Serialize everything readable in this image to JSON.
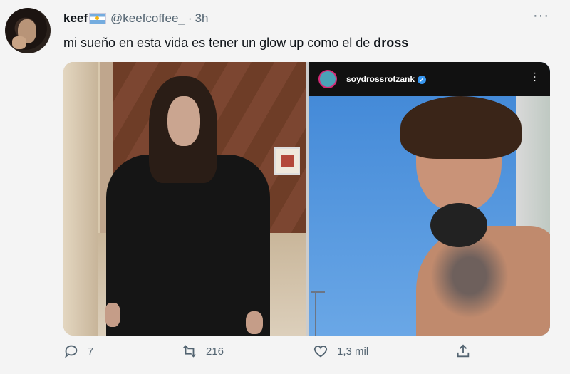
{
  "tweet": {
    "author_name": "keef",
    "handle": "@keefcoffee_",
    "separator": "·",
    "time": "3h",
    "more": "···",
    "text_plain": "mi sueño en esta vida es tener un glow up como el de ",
    "text_bold": "dross"
  },
  "media": {
    "right_photo": {
      "instagram_username": "soydrossrotzank",
      "verified_mark": "✓",
      "more": "···"
    }
  },
  "actions": {
    "reply_count": "7",
    "retweet_count": "216",
    "like_count": "1,3 mil"
  },
  "colors": {
    "muted_text": "#536471",
    "main_text": "#0f1419",
    "background": "#f4f4f4"
  }
}
